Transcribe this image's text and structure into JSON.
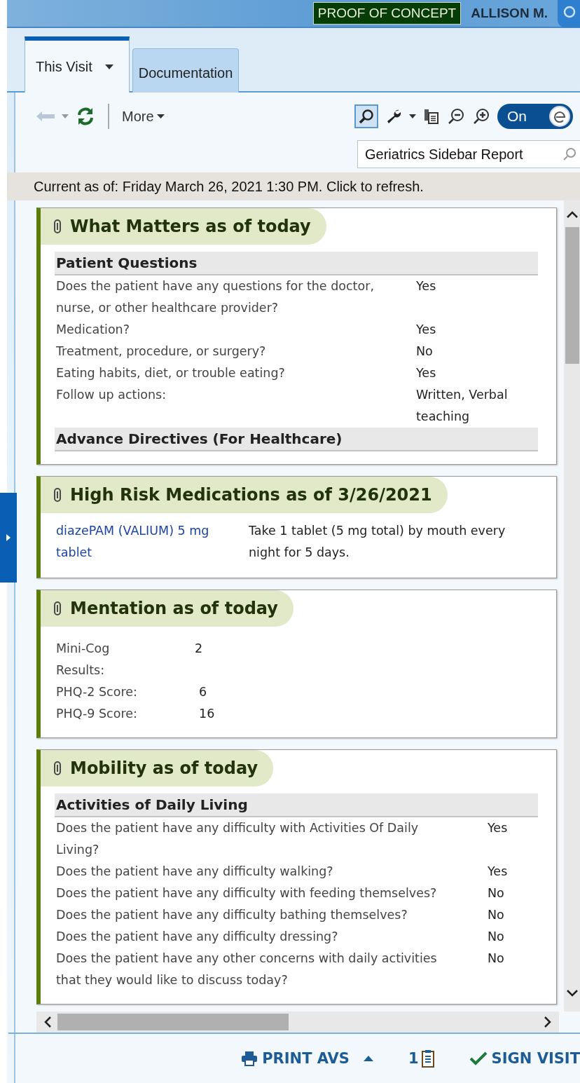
{
  "header": {
    "badge": "PROOF OF CONCEPT",
    "user": "ALLISON M."
  },
  "tabs": [
    {
      "label": "This Visit",
      "selected": true,
      "has_menu": true
    },
    {
      "label": "Documentation",
      "selected": false,
      "has_menu": false
    }
  ],
  "toolbar": {
    "more_label": "More",
    "search_selected": true,
    "toggle": {
      "label": "On",
      "on": true
    }
  },
  "report_search": {
    "value": "Geriatrics Sidebar Report"
  },
  "status_text": "Current as of: Friday March 26, 2021 1:30 PM. Click to refresh.",
  "cards": [
    {
      "kind": "sections",
      "title": "What Matters as of today",
      "sections": [
        {
          "heading": "Patient Questions",
          "rows": [
            {
              "label": "Does the patient have any questions for the doctor, nurse, or other healthcare provider?",
              "value": "Yes"
            },
            {
              "label": "Medication?",
              "value": "Yes"
            },
            {
              "label": "Treatment, procedure, or surgery?",
              "value": "No"
            },
            {
              "label": "Eating habits, diet, or trouble eating?",
              "value": "Yes"
            },
            {
              "label": "Follow up actions:",
              "value": "Written, Verbal teaching"
            }
          ]
        },
        {
          "heading": "Advance Directives (For Healthcare)"
        }
      ]
    },
    {
      "kind": "medications",
      "title": "High Risk Medications as of 3/26/2021",
      "rows": [
        {
          "label": "diazePAM (VALIUM) 5 mg tablet",
          "value": "Take 1 tablet (5 mg total) by mouth every night for 5 days."
        }
      ]
    },
    {
      "kind": "scores",
      "title": "Mentation as of today",
      "rows": [
        {
          "label": "Mini-Cog Results:",
          "value": "2"
        },
        {
          "label": "PHQ-2 Score:",
          "value": "6"
        },
        {
          "label": "PHQ-9 Score:",
          "value": "16"
        }
      ]
    },
    {
      "kind": "sections",
      "title": "Mobility as of today",
      "wide": true,
      "sections": [
        {
          "heading": "Activities of Daily Living",
          "rows": [
            {
              "label": "Does the patient have any difficulty with Activities Of Daily Living?",
              "value": "Yes"
            },
            {
              "label": "Does the patient have any difficulty walking?",
              "value": "Yes"
            },
            {
              "label": "Does the patient have any difficulty with feeding themselves?",
              "value": "No"
            },
            {
              "label": "Does the patient have any difficulty bathing themselves?",
              "value": "No"
            },
            {
              "label": "Does the patient have any difficulty dressing?",
              "value": "No"
            },
            {
              "label": "Does the patient have any other concerns with daily activities that they would like to discuss today?",
              "value": "No"
            }
          ]
        }
      ]
    }
  ],
  "footer": {
    "print_label": "PRINT AVS",
    "count": "1",
    "sign_label": "SIGN VISIT"
  }
}
